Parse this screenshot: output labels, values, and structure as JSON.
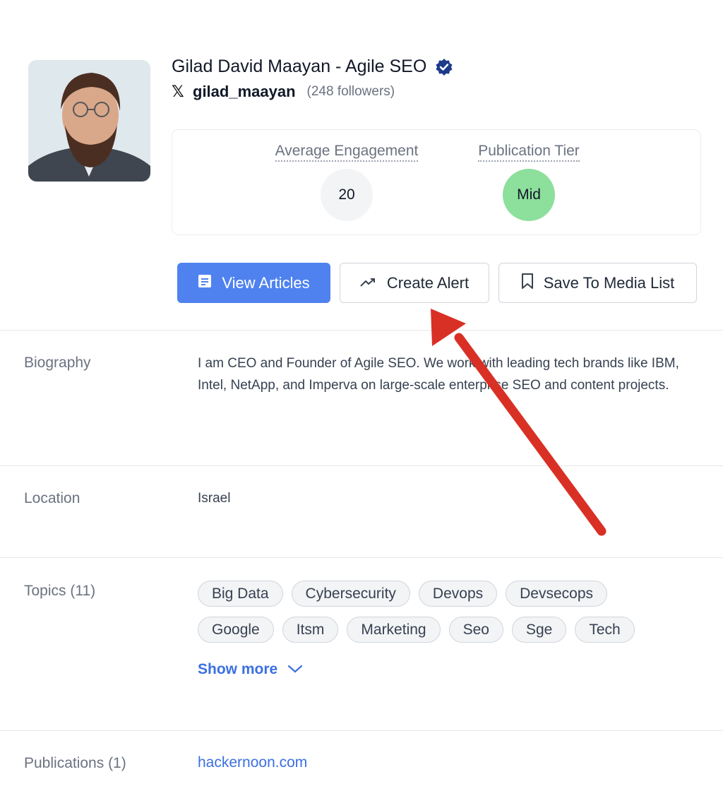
{
  "profile": {
    "name": "Gilad David Maayan - Agile SEO",
    "handle": "gilad_maayan",
    "followers": "(248 followers)"
  },
  "stats": {
    "engagement_label": "Average Engagement",
    "engagement_value": "20",
    "tier_label": "Publication Tier",
    "tier_value": "Mid"
  },
  "actions": {
    "view_articles": "View Articles",
    "create_alert": "Create Alert",
    "save_to_media_list": "Save To Media List"
  },
  "biography": {
    "label": "Biography",
    "text": "I am CEO and Founder of Agile SEO. We work with leading tech brands like IBM, Intel, NetApp, and Imperva on large-scale enterprise SEO and content projects."
  },
  "location": {
    "label": "Location",
    "value": "Israel"
  },
  "topics": {
    "label": "Topics (11)",
    "items": [
      "Big Data",
      "Cybersecurity",
      "Devops",
      "Devsecops",
      "Google",
      "Itsm",
      "Marketing",
      "Seo",
      "Sge",
      "Tech"
    ],
    "show_more": "Show more"
  },
  "publications": {
    "label": "Publications (1)",
    "items": [
      "hackernoon.com"
    ]
  },
  "colors": {
    "primary": "#4f82ef",
    "tier_mid": "#8ddf9c",
    "link": "#3b6fe0",
    "annotation_arrow": "#d93025"
  }
}
